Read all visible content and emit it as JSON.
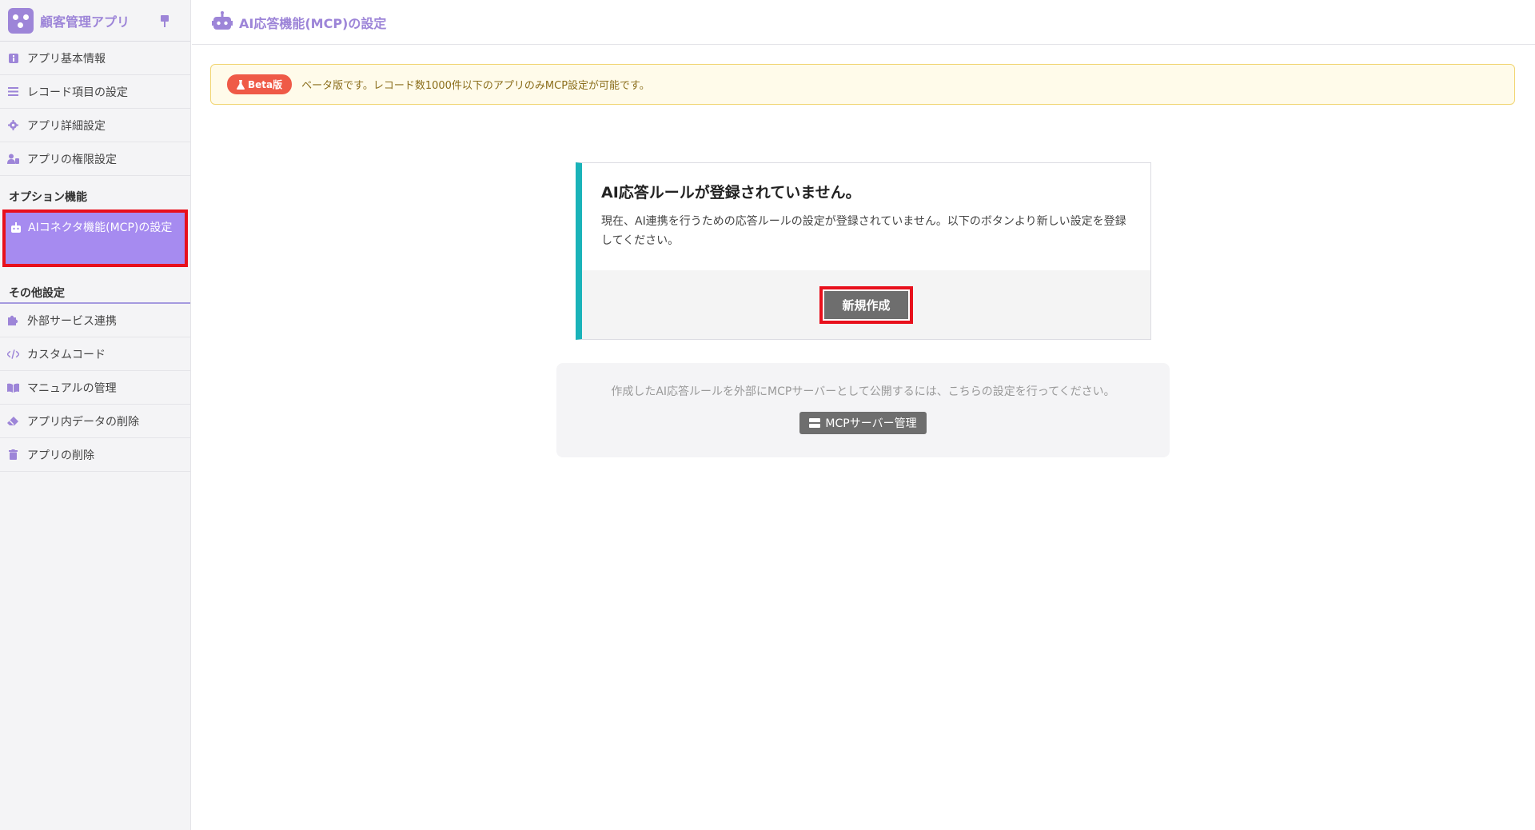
{
  "app": {
    "name": "顧客管理アプリ"
  },
  "sidebar": {
    "items": [
      {
        "label": "アプリ基本情報",
        "icon": "info-icon"
      },
      {
        "label": "レコード項目の設定",
        "icon": "list-icon"
      },
      {
        "label": "アプリ詳細設定",
        "icon": "gear-icon"
      },
      {
        "label": "アプリの権限設定",
        "icon": "users-icon"
      }
    ],
    "option_section": "オプション機能",
    "option_item": {
      "label": "AIコネクタ機能(MCP)の設定",
      "icon": "robot-icon"
    },
    "other_section": "その他設定",
    "other_items": [
      {
        "label": "外部サービス連携",
        "icon": "puzzle-icon"
      },
      {
        "label": "カスタムコード",
        "icon": "code-icon"
      },
      {
        "label": "マニュアルの管理",
        "icon": "book-icon"
      },
      {
        "label": "アプリ内データの削除",
        "icon": "eraser-icon"
      },
      {
        "label": "アプリの削除",
        "icon": "trash-icon"
      }
    ]
  },
  "header": {
    "title": "AI応答機能(MCP)の設定"
  },
  "beta": {
    "badge": "Beta版",
    "text": "ベータ版です。レコード数1000件以下のアプリのみMCP設定が可能です。"
  },
  "card": {
    "title": "AI応答ルールが登録されていません。",
    "text": "現在、AI連携を行うための応答ルールの設定が登録されていません。以下のボタンより新しい設定を登録してください。",
    "button": "新規作成"
  },
  "mcp": {
    "text": "作成したAI応答ルールを外部にMCPサーバーとして公開するには、こちらの設定を行ってください。",
    "button": "MCPサーバー管理"
  },
  "colors": {
    "accent": "#9d85d8",
    "active_bg": "#a68bf0",
    "highlight": "#e8101c",
    "card_border": "#1ab3b9",
    "beta_badge": "#ef5a47"
  }
}
